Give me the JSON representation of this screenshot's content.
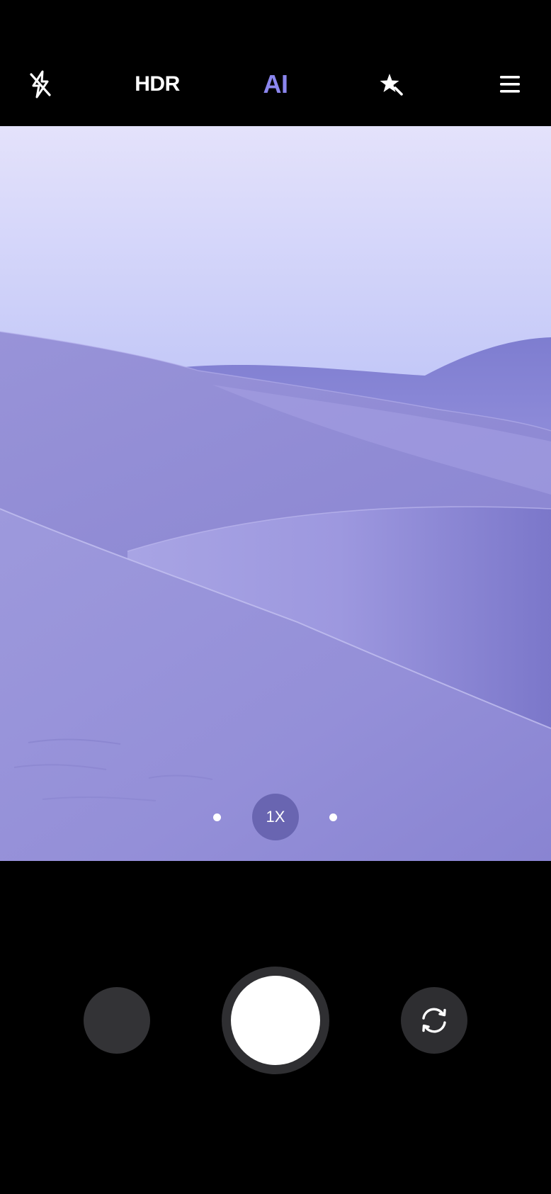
{
  "top_toolbar": {
    "flash": {
      "icon": "flash-off-icon"
    },
    "hdr_label": "HDR",
    "ai_label": "AI",
    "ai_color": "#8b86ee",
    "effects": {
      "icon": "magic-star-icon"
    },
    "menu": {
      "icon": "menu-icon"
    }
  },
  "viewfinder": {
    "scene": "desert-dunes",
    "sky_top_color": "#e4e2fb",
    "sky_bottom_color": "#8da5f8",
    "dune_color": "#8e89d4"
  },
  "zoom": {
    "selected_label": "1X",
    "chip_color": "#625eaa"
  },
  "bottom_bar": {
    "gallery_thumbnail": {
      "icon": "gallery-thumbnail"
    },
    "shutter": {
      "icon": "shutter-button"
    },
    "switch_camera": {
      "icon": "switch-camera-icon"
    }
  }
}
